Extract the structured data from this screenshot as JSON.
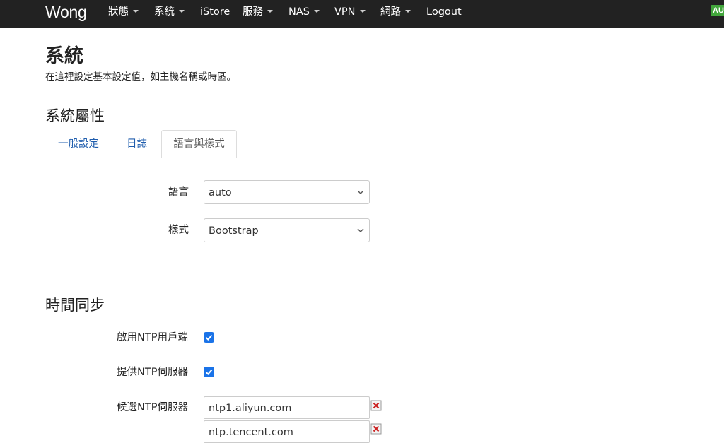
{
  "navbar": {
    "brand": "Wong",
    "items": [
      {
        "label": "狀態",
        "dropdown": true
      },
      {
        "label": "系統",
        "dropdown": true
      },
      {
        "label": "iStore",
        "dropdown": false
      },
      {
        "label": "服務",
        "dropdown": true
      },
      {
        "label": "NAS",
        "dropdown": true
      },
      {
        "label": "VPN",
        "dropdown": true
      },
      {
        "label": "網路",
        "dropdown": true
      },
      {
        "label": "Logout",
        "dropdown": false
      }
    ],
    "badge": "AUTO"
  },
  "page": {
    "title": "系統",
    "description": "在這裡設定基本設定值，如主機名稱或時區。"
  },
  "properties": {
    "title": "系統屬性",
    "tabs": [
      {
        "label": "一般設定",
        "active": false
      },
      {
        "label": "日誌",
        "active": false
      },
      {
        "label": "語言與樣式",
        "active": true
      }
    ],
    "language": {
      "label": "語言",
      "value": "auto"
    },
    "theme": {
      "label": "樣式",
      "value": "Bootstrap"
    }
  },
  "timesync": {
    "title": "時間同步",
    "enable_client": {
      "label": "啟用NTP用戶端",
      "checked": true
    },
    "enable_server": {
      "label": "提供NTP伺服器",
      "checked": true
    },
    "candidates": {
      "label": "候選NTP伺服器",
      "servers": [
        "ntp1.aliyun.com",
        "ntp.tencent.com"
      ]
    }
  },
  "colors": {
    "navbar_bg": "#222222",
    "link": "#1f5dad",
    "checkbox": "#1a73e8",
    "badge": "#42a63c",
    "remove_icon": "#cc2222"
  }
}
